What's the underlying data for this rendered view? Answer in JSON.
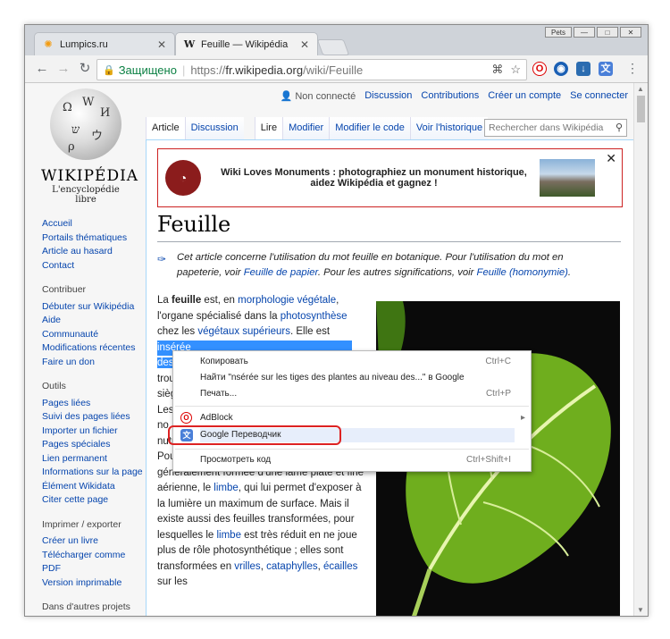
{
  "browser": {
    "tabs": [
      {
        "title": "Lumpics.ru",
        "active": false
      },
      {
        "title": "Feuille — Wikipédia",
        "active": true
      }
    ],
    "window_user": "Pets",
    "secure_label": "Защищено",
    "url_scheme": "https://",
    "url_host": "fr.wikipedia.org",
    "url_path": "/wiki/Feuille"
  },
  "wiki": {
    "personal": [
      "Non connecté",
      "Discussion",
      "Contributions",
      "Créer un compte",
      "Se connecter"
    ],
    "logo_word": "WIKIPÉDIA",
    "logo_tagline": "L'encyclopédie libre",
    "tabs_left": [
      "Article",
      "Discussion"
    ],
    "tabs_right": [
      "Lire",
      "Modifier",
      "Modifier le code",
      "Voir l'historique"
    ],
    "search_placeholder": "Rechercher dans Wikipédia",
    "sidebar": {
      "main": [
        "Accueil",
        "Portails thématiques",
        "Article au hasard",
        "Contact"
      ],
      "contribuer_title": "Contribuer",
      "contribuer": [
        "Débuter sur Wikipédia",
        "Aide",
        "Communauté",
        "Modifications récentes",
        "Faire un don"
      ],
      "outils_title": "Outils",
      "outils": [
        "Pages liées",
        "Suivi des pages liées",
        "Importer un fichier",
        "Pages spéciales",
        "Lien permanent",
        "Informations sur la page",
        "Élément Wikidata",
        "Citer cette page"
      ],
      "imprimer_title": "Imprimer / exporter",
      "imprimer": [
        "Créer un livre",
        "Télécharger comme PDF",
        "Version imprimable"
      ],
      "autres_title": "Dans d'autres projets"
    },
    "banner": {
      "text": "Wiki Loves Monuments : photographiez un monument historique, aidez Wikipédia et gagnez !",
      "close": "✕"
    },
    "title": "Feuille",
    "hatnote": {
      "t1": "Cet article concerne l'utilisation du mot feuille en botanique. Pour l'utilisation du mot en papeterie, voir ",
      "l1": "Feuille de papier",
      "t2": ". Pour les autres significations, voir ",
      "l2": "Feuille (homonymie)",
      "t3": "."
    },
    "body": {
      "p1a": "La ",
      "p1b": "feuille",
      "p1c": " est, en ",
      "p1d": "morphologie végétale",
      "p1e": ", l'organe spécialisé dans la ",
      "p1f": "photosynthèse",
      "p1g": " chez les ",
      "p1h": "végétaux supérieurs",
      "p1i": ". Elle est",
      "sel1": "insérée",
      "sel2": "des",
      "frag1": "trou",
      "frag2": "sièg",
      "frag3": "Les",
      "frag4": "no",
      "frag5": "nutr",
      "p2a": "Pour accomplir son rôle, une feuille est généralement formée d'une lame plate et fine aérienne, le ",
      "p2b": "limbe",
      "p2c": ", qui lui permet d'exposer à la lumière un maximum de surface. Mais il existe aussi des feuilles transformées, pour lesquelles le ",
      "p2d": "limbe",
      "p2e": " est très réduit en ne joue plus de rôle photosynthétique ; elles sont transformées en ",
      "p2f": "vrilles",
      "p2g": ", ",
      "p2h": "cataphylles",
      "p2i": ", ",
      "p2j": "écailles",
      "p2k": " sur les"
    }
  },
  "context_menu": {
    "copy": "Копировать",
    "copy_sc": "Ctrl+C",
    "search": "Найти \"nsérée sur les tiges des plantes au niveau des...\" в Google",
    "print": "Печать...",
    "print_sc": "Ctrl+P",
    "adblock": "AdBlock",
    "translate": "Google Переводчик",
    "inspect": "Просмотреть код",
    "inspect_sc": "Ctrl+Shift+I"
  },
  "colors": {
    "link": "#0645ad",
    "secure": "#0b8043",
    "highlight": "#3390ff",
    "callout": "#dd2222"
  }
}
